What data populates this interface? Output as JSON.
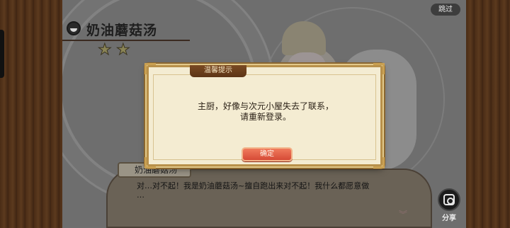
{
  "header": {
    "skip_label": "跳过",
    "dish_name": "奶油蘑菇汤",
    "star_count": 2,
    "star_glyph": "★"
  },
  "modal": {
    "title": "温馨提示",
    "message_line1": "主厨，好像与次元小屋失去了联系，",
    "message_line2": "请重新登录。",
    "confirm_label": "确定"
  },
  "dialogue": {
    "speaker": "奶油蘑菇汤",
    "text_line1": "对…对不起！我是奶油蘑菇汤~擅自跑出来对不起！我什么都愿意做",
    "text_line2": "…",
    "chevron": "︾"
  },
  "share": {
    "label": "分享",
    "icon": "instagram-camera-icon"
  },
  "colors": {
    "frame_wood": "#4a2c16",
    "modal_bg": "#f4ecd2",
    "modal_border": "#b8904a",
    "confirm_btn": "#e05e46",
    "title_tab": "#6a3e1c"
  }
}
